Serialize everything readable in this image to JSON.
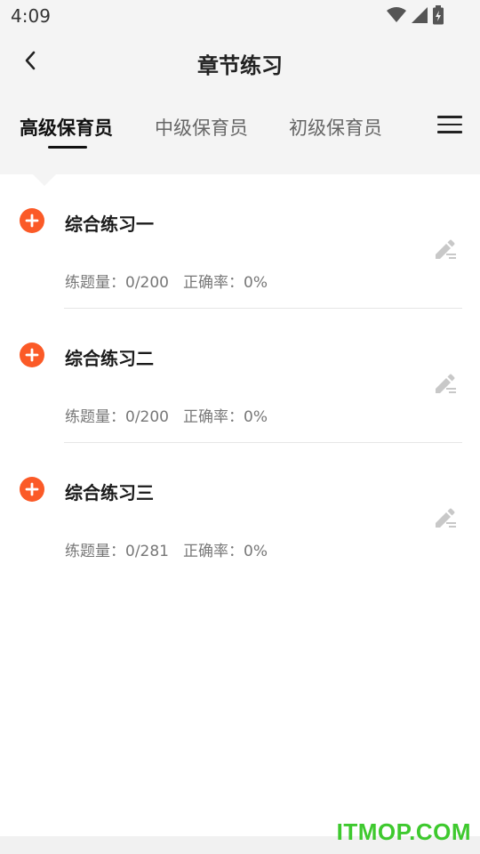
{
  "status_bar": {
    "time": "4:09",
    "icons": [
      "wifi-icon",
      "signal-icon",
      "battery-icon"
    ]
  },
  "header": {
    "back_icon": "chevron-left-icon",
    "title": "章节练习"
  },
  "tabs": [
    {
      "label": "高级保育员",
      "active": true
    },
    {
      "label": "中级保育员",
      "active": false
    },
    {
      "label": "初级保育员",
      "active": false
    }
  ],
  "menu_icon": "hamburger-menu-icon",
  "stats_labels": {
    "count_label": "练题量：",
    "accuracy_label": "正确率："
  },
  "items": [
    {
      "title": "综合练习一",
      "count": "0/200",
      "accuracy": "0%"
    },
    {
      "title": "综合练习二",
      "count": "0/200",
      "accuracy": "0%"
    },
    {
      "title": "综合练习三",
      "count": "0/281",
      "accuracy": "0%"
    }
  ],
  "colors": {
    "accent": "#fb5a27",
    "watermark": "#3ec92e"
  },
  "watermark": "ITMOP.COM"
}
